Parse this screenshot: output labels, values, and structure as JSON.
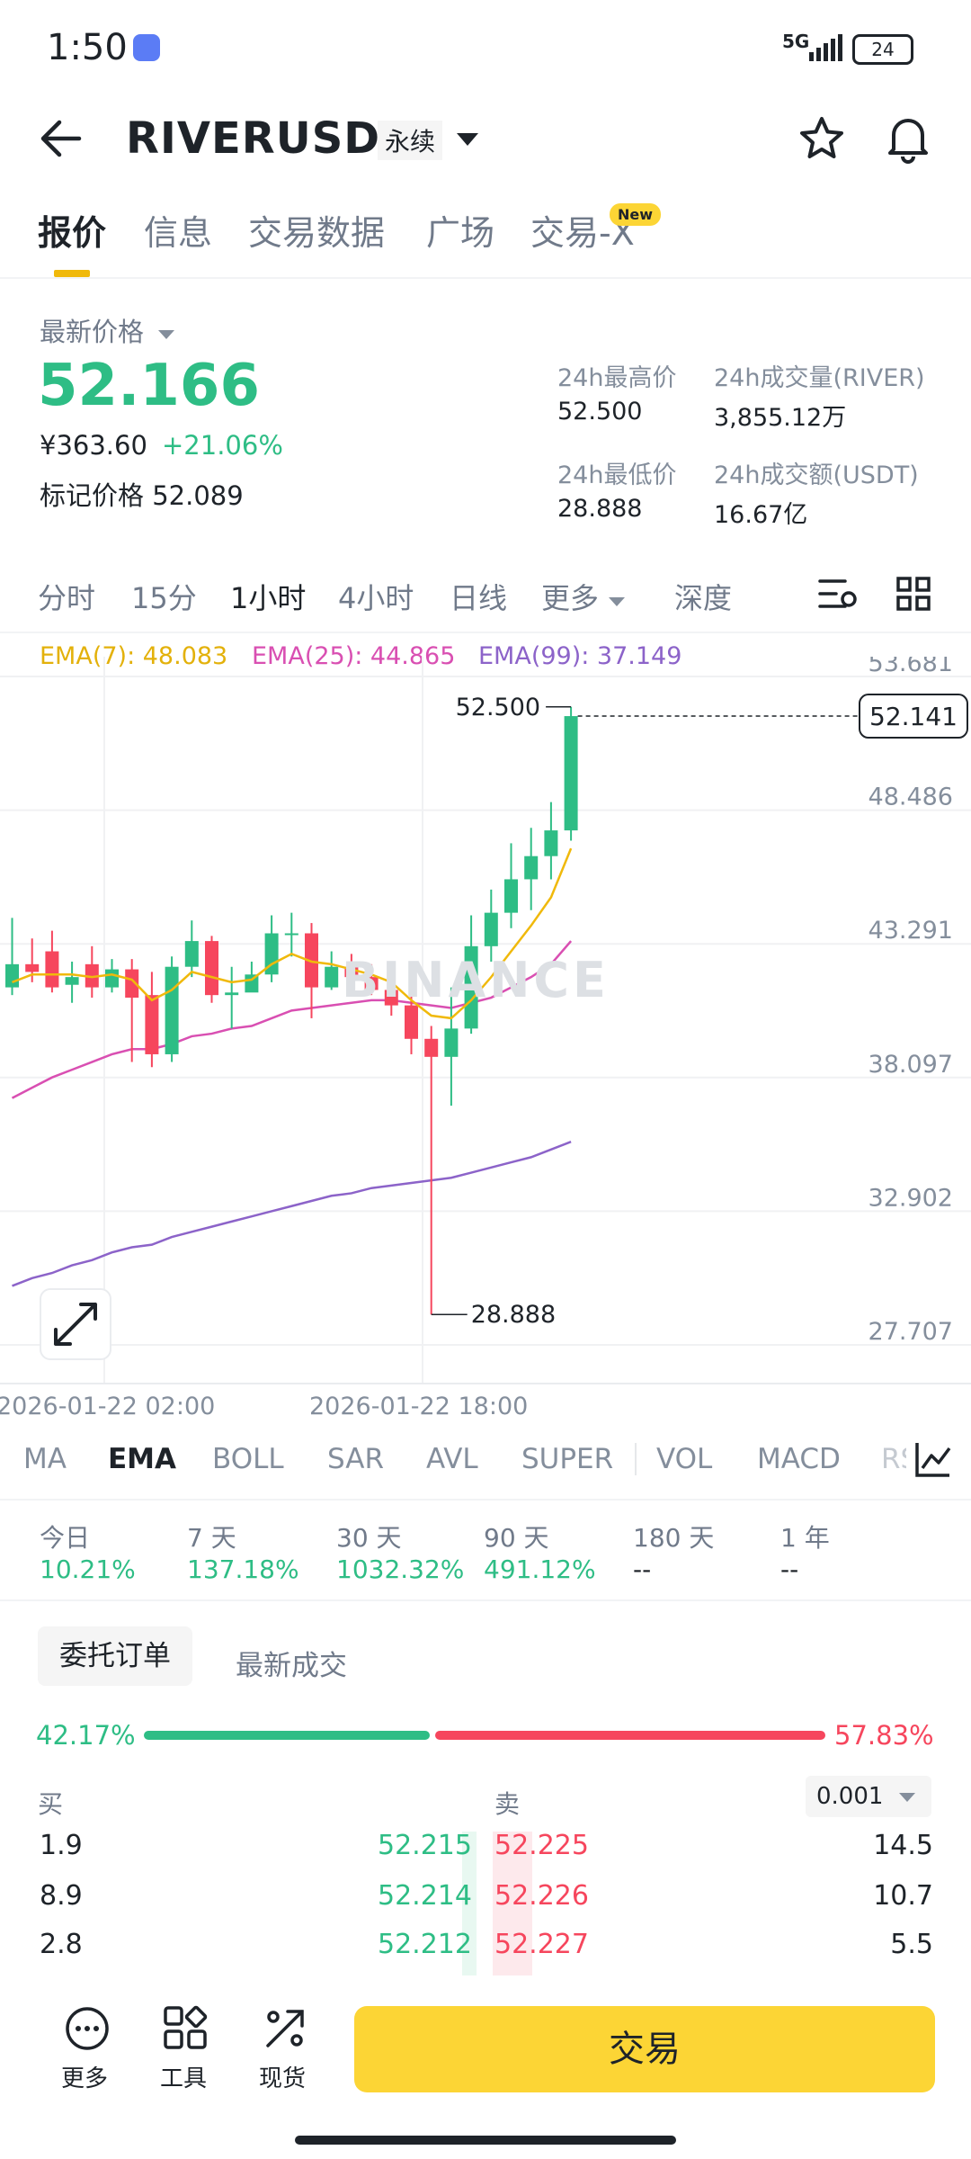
{
  "status": {
    "time": "1:50",
    "network": "5G",
    "battery": "24"
  },
  "header": {
    "symbol": "RIVERUSDT",
    "contract": "永续"
  },
  "tabs": [
    {
      "label": "报价",
      "active": true
    },
    {
      "label": "信息",
      "active": false
    },
    {
      "label": "交易数据",
      "active": false
    },
    {
      "label": "广场",
      "active": false
    },
    {
      "label": "交易-X",
      "active": false
    }
  ],
  "new_badge": "New",
  "price": {
    "latest_label": "最新价格",
    "last": "52.166",
    "cny": "¥363.60",
    "change_pct": "+21.06%",
    "mark_label": "标记价格",
    "mark": "52.089"
  },
  "stats": {
    "high_label": "24h最高价",
    "high": "52.500",
    "vol_label": "24h成交量(RIVER)",
    "vol": "3,855.12万",
    "low_label": "24h最低价",
    "low": "28.888",
    "turnover_label": "24h成交额(USDT)",
    "turnover": "16.67亿"
  },
  "timeframes": [
    {
      "label": "分时",
      "active": false
    },
    {
      "label": "15分",
      "active": false
    },
    {
      "label": "1小时",
      "active": true
    },
    {
      "label": "4小时",
      "active": false
    },
    {
      "label": "日线",
      "active": false
    },
    {
      "label": "更多",
      "active": false
    },
    {
      "label": "深度",
      "active": false
    }
  ],
  "ema_legend": {
    "ema7": "EMA(7): 48.083",
    "ema25": "EMA(25): 44.865",
    "ema99": "EMA(99): 37.149"
  },
  "watermark": "BINANCE",
  "colors": {
    "up": "#2ebd85",
    "down": "#f6465d",
    "ema7": "#f0b90b",
    "ema25": "#d94fb2",
    "ema99": "#8c63c9",
    "accent": "#fcd535"
  },
  "chart_data": {
    "type": "candlestick",
    "y_ticks": [
      "53.681",
      "48.486",
      "43.291",
      "38.097",
      "32.902",
      "27.707"
    ],
    "ylim": [
      27.707,
      53.681
    ],
    "x_labels": [
      "2026-01-22 02:00",
      "2026-01-22 18:00"
    ],
    "current_price": "52.141",
    "high_label": "52.500",
    "low_label": "28.888",
    "candles": [
      [
        41.6,
        42.5,
        44.3,
        41.3
      ],
      [
        42.5,
        42.2,
        43.5,
        41.8
      ],
      [
        43.0,
        41.6,
        43.8,
        41.4
      ],
      [
        41.7,
        42.0,
        42.6,
        41.0
      ],
      [
        42.5,
        41.6,
        43.2,
        41.2
      ],
      [
        41.6,
        42.3,
        42.7,
        41.4
      ],
      [
        42.3,
        41.2,
        42.7,
        38.7
      ],
      [
        41.3,
        39.0,
        42.2,
        38.5
      ],
      [
        39.0,
        42.4,
        42.8,
        38.7
      ],
      [
        42.4,
        43.4,
        44.2,
        42.0
      ],
      [
        43.4,
        41.3,
        43.6,
        41.0
      ],
      [
        41.3,
        41.4,
        42.4,
        40.0
      ],
      [
        41.4,
        42.1,
        42.6,
        41.7
      ],
      [
        42.1,
        43.7,
        44.4,
        41.8
      ],
      [
        43.7,
        43.7,
        44.5,
        42.8
      ],
      [
        43.7,
        41.6,
        44.1,
        40.4
      ],
      [
        41.6,
        42.4,
        43.0,
        41.5
      ],
      [
        42.4,
        42.0,
        42.9,
        41.6
      ],
      [
        42.0,
        41.5,
        42.5,
        41.3
      ],
      [
        41.5,
        40.9,
        42.2,
        40.5
      ],
      [
        40.9,
        39.6,
        41.7,
        39.0
      ],
      [
        39.6,
        38.9,
        40.1,
        28.888
      ],
      [
        38.9,
        40.0,
        41.6,
        37.0
      ],
      [
        40.0,
        43.2,
        44.4,
        39.8
      ],
      [
        43.2,
        44.5,
        45.4,
        42.6
      ],
      [
        44.5,
        45.8,
        47.2,
        43.9
      ],
      [
        45.8,
        46.7,
        47.8,
        44.6
      ],
      [
        46.7,
        47.7,
        48.8,
        45.8
      ],
      [
        47.7,
        52.141,
        52.5,
        47.3
      ]
    ],
    "ema7": [
      41.8,
      42.1,
      42.1,
      42.1,
      42.0,
      42.1,
      41.9,
      41.1,
      41.5,
      42.2,
      42.0,
      41.8,
      41.9,
      42.5,
      42.9,
      42.6,
      42.5,
      42.3,
      42.1,
      41.8,
      41.1,
      40.5,
      40.4,
      41.1,
      42.0,
      43.0,
      44.0,
      45.1,
      47.0
    ],
    "ema25": [
      37.3,
      37.7,
      38.1,
      38.4,
      38.7,
      39.0,
      39.2,
      39.2,
      39.4,
      39.7,
      39.8,
      40.0,
      40.1,
      40.4,
      40.7,
      40.8,
      40.9,
      41.0,
      41.1,
      41.1,
      41.0,
      40.9,
      40.8,
      41.0,
      41.2,
      41.6,
      42.0,
      42.5,
      43.4
    ],
    "ema99": [
      30.0,
      30.3,
      30.5,
      30.8,
      31.0,
      31.3,
      31.5,
      31.6,
      31.9,
      32.1,
      32.3,
      32.5,
      32.7,
      32.9,
      33.1,
      33.3,
      33.5,
      33.6,
      33.8,
      33.9,
      34.0,
      34.1,
      34.2,
      34.4,
      34.6,
      34.8,
      35.0,
      35.3,
      35.6
    ]
  },
  "indicators": [
    {
      "label": "MA",
      "active": false
    },
    {
      "label": "EMA",
      "active": true
    },
    {
      "label": "BOLL",
      "active": false
    },
    {
      "label": "SAR",
      "active": false
    },
    {
      "label": "AVL",
      "active": false
    },
    {
      "label": "SUPER",
      "active": false
    },
    {
      "label": "VOL",
      "active": false
    },
    {
      "label": "MACD",
      "active": false
    },
    {
      "label": "RSI",
      "active": false
    }
  ],
  "performance": [
    {
      "label": "今日",
      "value": "10.21%"
    },
    {
      "label": "7 天",
      "value": "137.18%"
    },
    {
      "label": "30 天",
      "value": "1032.32%"
    },
    {
      "label": "90 天",
      "value": "491.12%"
    },
    {
      "label": "180 天",
      "value": "--"
    },
    {
      "label": "1 年",
      "value": "--"
    }
  ],
  "orderbook": {
    "tab_active": "委托订单",
    "tab_other": "最新成交",
    "buy_ratio": "42.17%",
    "sell_ratio": "57.83%",
    "buy_header": "买",
    "sell_header": "卖",
    "precision": "0.001",
    "rows": [
      {
        "buy_qty": "1.9",
        "buy_price": "52.215",
        "sell_price": "52.225",
        "sell_qty": "14.5"
      },
      {
        "buy_qty": "8.9",
        "buy_price": "52.214",
        "sell_price": "52.226",
        "sell_qty": "10.7"
      },
      {
        "buy_qty": "2.8",
        "buy_price": "52.212",
        "sell_price": "52.227",
        "sell_qty": "5.5"
      }
    ]
  },
  "bottom_nav": {
    "more": "更多",
    "tools": "工具",
    "spot": "现货",
    "trade": "交易"
  }
}
